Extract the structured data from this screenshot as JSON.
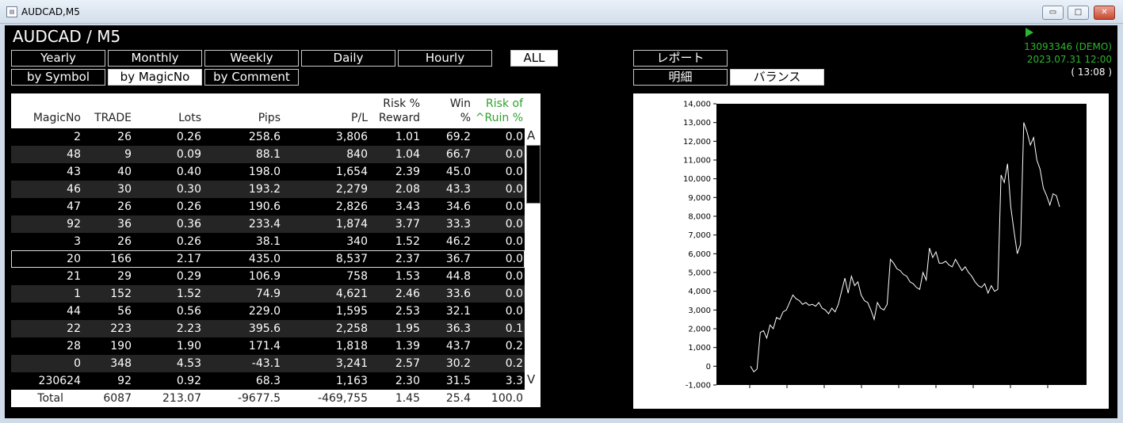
{
  "window": {
    "title": "AUDCAD,M5",
    "icon": "chart-app-icon",
    "minimize": "▭",
    "maximize": "□",
    "close": "✕"
  },
  "header": {
    "title": "AUDCAD / M5"
  },
  "period_tabs": [
    {
      "label": "Yearly",
      "active": false
    },
    {
      "label": "Monthly",
      "active": false
    },
    {
      "label": "Weekly",
      "active": false
    },
    {
      "label": "Daily",
      "active": false
    },
    {
      "label": "Hourly",
      "active": false
    },
    {
      "label": "ALL",
      "active": true
    }
  ],
  "group_tabs": [
    {
      "label": "by Symbol",
      "active": false
    },
    {
      "label": "by MagicNo",
      "active": true
    },
    {
      "label": "by Comment",
      "active": false
    }
  ],
  "report_tabs": [
    {
      "label": "レポート",
      "active": false
    },
    {
      "label": "明細",
      "active": false
    },
    {
      "label": "バランス",
      "active": true
    }
  ],
  "account": {
    "id": "13093346 (DEMO)",
    "datetime": "2023.07.31 12:00",
    "elapsed": "( 13:08 )"
  },
  "table": {
    "columns": [
      {
        "line1": "",
        "line2": "MagicNo"
      },
      {
        "line1": "",
        "line2": "TRADE"
      },
      {
        "line1": "",
        "line2": "Lots"
      },
      {
        "line1": "",
        "line2": "Pips"
      },
      {
        "line1": "",
        "line2": "P/L"
      },
      {
        "line1": "Risk %",
        "line2": "Reward"
      },
      {
        "line1": "Win",
        "line2": "%"
      },
      {
        "line1": "Risk of",
        "line2": "^Ruin %"
      }
    ],
    "rows": [
      [
        "2",
        "26",
        "0.26",
        "258.6",
        "3,806",
        "1.01",
        "69.2",
        "0.0"
      ],
      [
        "48",
        "9",
        "0.09",
        "88.1",
        "840",
        "1.04",
        "66.7",
        "0.0"
      ],
      [
        "43",
        "40",
        "0.40",
        "198.0",
        "1,654",
        "2.39",
        "45.0",
        "0.0"
      ],
      [
        "46",
        "30",
        "0.30",
        "193.2",
        "2,279",
        "2.08",
        "43.3",
        "0.0"
      ],
      [
        "47",
        "26",
        "0.26",
        "190.6",
        "2,826",
        "3.43",
        "34.6",
        "0.0"
      ],
      [
        "92",
        "36",
        "0.36",
        "233.4",
        "1,874",
        "3.77",
        "33.3",
        "0.0"
      ],
      [
        "3",
        "26",
        "0.26",
        "38.1",
        "340",
        "1.52",
        "46.2",
        "0.0"
      ],
      [
        "20",
        "166",
        "2.17",
        "435.0",
        "8,537",
        "2.37",
        "36.7",
        "0.0"
      ],
      [
        "21",
        "29",
        "0.29",
        "106.9",
        "758",
        "1.53",
        "44.8",
        "0.0"
      ],
      [
        "1",
        "152",
        "1.52",
        "74.9",
        "4,621",
        "2.46",
        "33.6",
        "0.0"
      ],
      [
        "44",
        "56",
        "0.56",
        "229.0",
        "1,595",
        "2.53",
        "32.1",
        "0.0"
      ],
      [
        "22",
        "223",
        "2.23",
        "395.6",
        "2,258",
        "1.95",
        "36.3",
        "0.1"
      ],
      [
        "28",
        "190",
        "1.90",
        "171.4",
        "1,818",
        "1.39",
        "43.7",
        "0.2"
      ],
      [
        "0",
        "348",
        "4.53",
        "-43.1",
        "3,241",
        "2.57",
        "30.2",
        "0.2"
      ],
      [
        "230624",
        "92",
        "0.92",
        "68.3",
        "1,163",
        "2.30",
        "31.5",
        "3.3"
      ]
    ],
    "selected_row": 7,
    "total": [
      "Total",
      "6087",
      "213.07",
      "-9677.5",
      "-469,755",
      "1.45",
      "25.4",
      "100.0"
    ],
    "scroll_up_label": "A",
    "scroll_down_label": "V"
  },
  "chart_data": {
    "type": "line",
    "ylim": [
      -1000,
      14000
    ],
    "yticks": [
      "14,000",
      "13,000",
      "12,000",
      "11,000",
      "10,000",
      "9,000",
      "8,000",
      "7,000",
      "6,000",
      "5,000",
      "4,000",
      "3,000",
      "2,000",
      "1,000",
      "0",
      "-1,000"
    ],
    "series": [
      {
        "values": [
          0,
          -300,
          -150,
          1800,
          1900,
          1500,
          2200,
          2000,
          2600,
          2500,
          2900,
          3000,
          3400,
          3800,
          3600,
          3500,
          3300,
          3400,
          3250,
          3300,
          3200,
          3400,
          3100,
          3000,
          2800,
          3100,
          2900,
          3300,
          4000,
          4700,
          3900,
          4800,
          4300,
          4500,
          3800,
          3500,
          3400,
          3000,
          2500,
          3400,
          3100,
          3000,
          3300,
          5700,
          5500,
          5200,
          5100,
          4900,
          4800,
          4500,
          4400,
          4200,
          4100,
          5000,
          4600,
          6300,
          5800,
          6100,
          5500,
          5500,
          5600,
          5400,
          5300,
          5700,
          5400,
          5100,
          5300,
          5000,
          4800,
          4500,
          4300,
          4200,
          4400,
          3900,
          4300,
          4000,
          4100,
          10200,
          9800,
          10800,
          8500,
          7200,
          6000,
          6500,
          13000,
          12500,
          11800,
          12200,
          11000,
          10500,
          9500,
          9100,
          8600,
          9200,
          9100,
          8500
        ]
      }
    ]
  }
}
